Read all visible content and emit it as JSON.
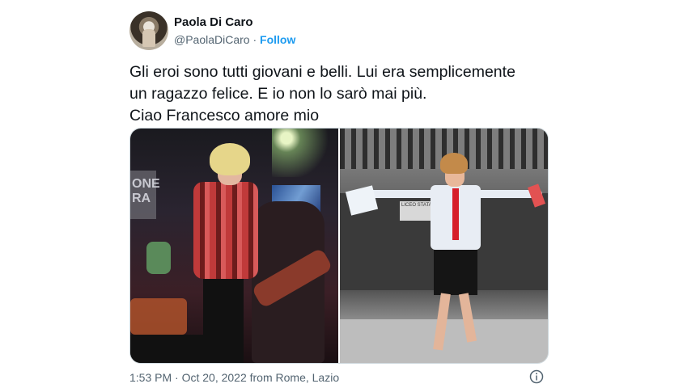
{
  "author": {
    "name": "Paola Di Caro",
    "handle": "@PaolaDiCaro",
    "separator": "·",
    "follow_label": "Follow"
  },
  "tweet": {
    "text": "Gli eroi sono tutti giovani e belli. Lui era semplicemente\nun ragazzo felice. E io non lo sarò mai più.\nCiao Francesco amore mio"
  },
  "media": {
    "left_banner_text": "ONE\nRA",
    "sign_text": "LICEO STATALE"
  },
  "footer": {
    "timestamp": "1:53 PM · Oct 20, 2022 from Rome, Lazio"
  },
  "icons": {
    "info": "info-icon"
  },
  "colors": {
    "accent": "#1d9bf0",
    "text": "#0f1419",
    "secondary": "#536471"
  }
}
